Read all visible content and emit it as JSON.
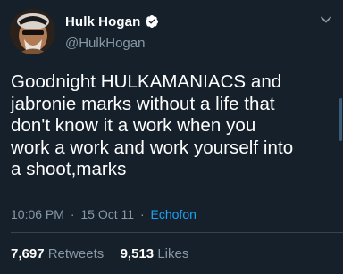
{
  "author": {
    "display_name": "Hulk Hogan",
    "handle": "@HulkHogan",
    "verified": true,
    "avatar": "profile-photo"
  },
  "tweet": {
    "text_lines": [
      "Goodnight HULKAMANIACS and",
      "jabronie marks without a life that",
      "don't know it a work when you",
      "work a work and work yourself into",
      "a shoot,marks"
    ],
    "time": "10:06 PM",
    "separator": "·",
    "date": "15 Oct 11",
    "source": "Echofon"
  },
  "stats": {
    "retweets_count": "7,697",
    "retweets_label": "Retweets",
    "likes_count": "9,513",
    "likes_label": "Likes"
  },
  "icons": {
    "verified": "verified-badge-icon",
    "menu": "chevron-down-icon"
  },
  "colors": {
    "background": "#15202b",
    "text": "#ffffff",
    "secondary_text": "#8899a6",
    "link": "#1da1f2",
    "verified_badge": "#ffffff"
  }
}
